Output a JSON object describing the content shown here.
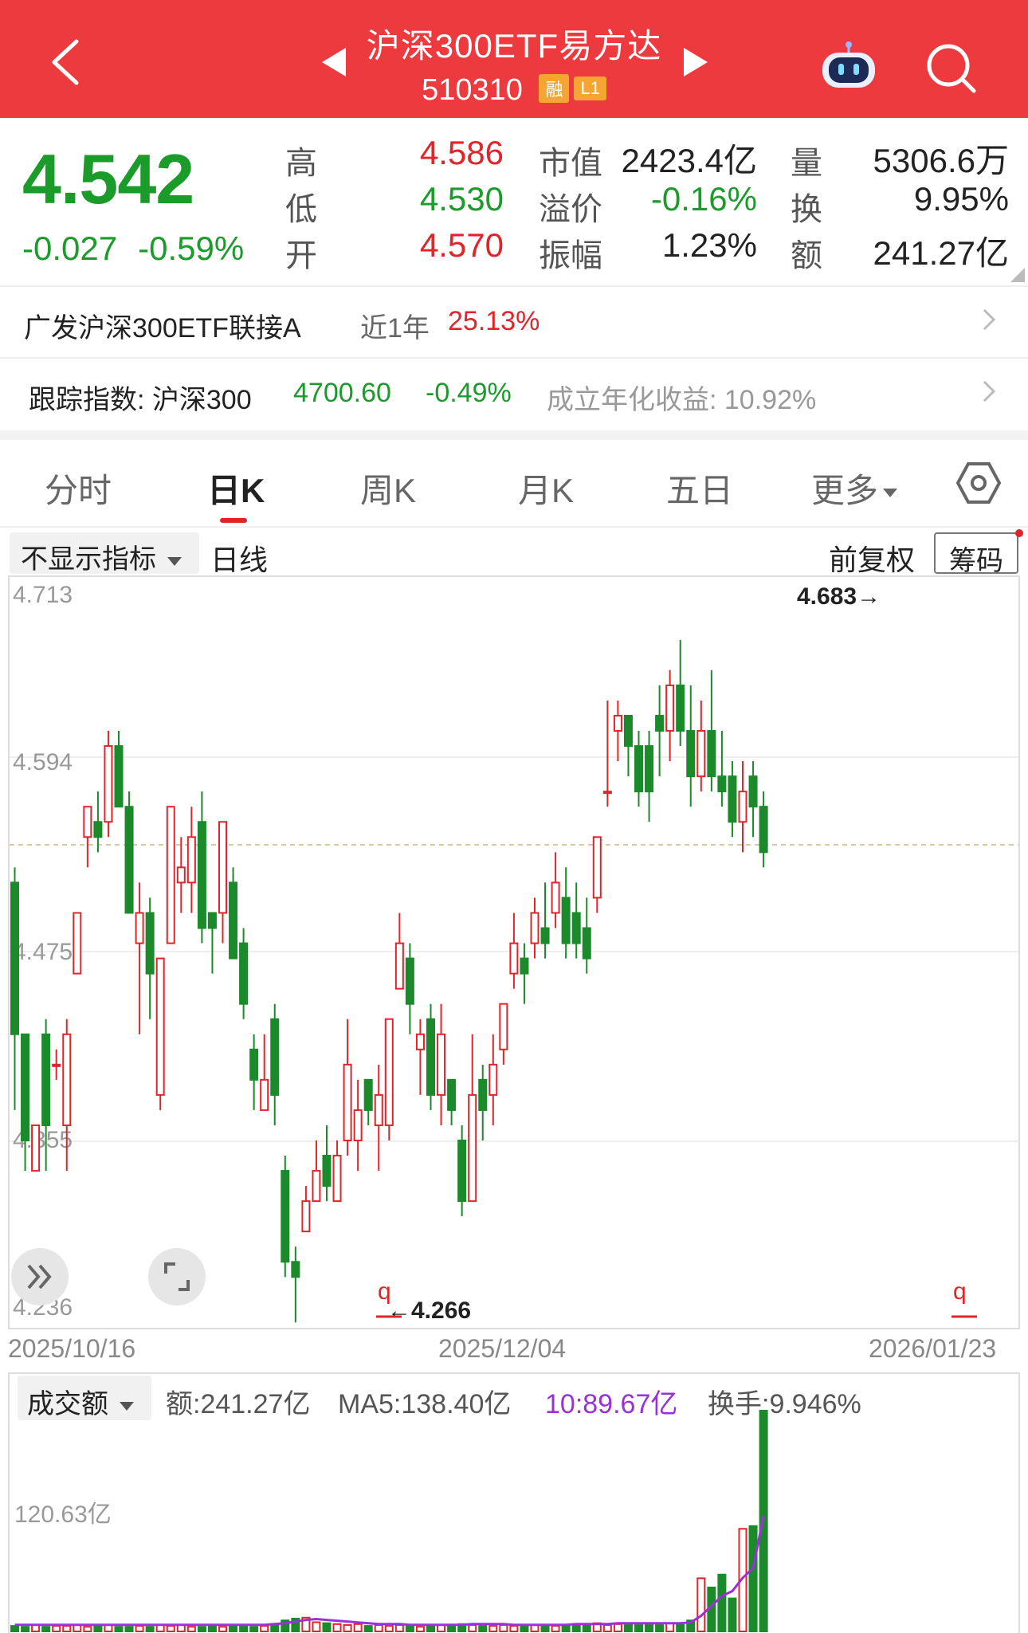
{
  "header": {
    "title": "沪深300ETF易方达",
    "code": "510310",
    "badge_margin": "融",
    "badge_level": "L1"
  },
  "quote": {
    "price": "4.542",
    "change": "-0.027",
    "change_pct": "-0.59%",
    "high_label": "高",
    "high": "4.586",
    "low_label": "低",
    "low": "4.530",
    "open_label": "开",
    "open": "4.570",
    "mktcap_label": "市值",
    "mktcap": "2423.4亿",
    "premium_label": "溢价",
    "premium": "-0.16%",
    "amp_label": "振幅",
    "amp": "1.23%",
    "vol_label": "量",
    "vol": "5306.6万",
    "turnover_label": "换",
    "turnover": "9.95%",
    "amount_label": "额",
    "amount": "241.27亿"
  },
  "fund_row": {
    "name": "广发沪深300ETF联接A",
    "period": "近1年",
    "return": "25.13%"
  },
  "index_row": {
    "label": "跟踪指数: 沪深300",
    "value": "4700.60",
    "change": "-0.49%",
    "annual": "成立年化收益: 10.92%"
  },
  "tabs": [
    "分时",
    "日K",
    "周K",
    "月K",
    "五日",
    "更多"
  ],
  "active_tab": "日K",
  "subbar": {
    "indicator": "不显示指标",
    "line_type": "日线",
    "adjust": "前复权",
    "chips": "筹码"
  },
  "colors": {
    "up": "#e1242a",
    "down": "#1a8a2a",
    "ma_purple": "#9b30d9"
  },
  "chart_data": [
    {
      "type": "candlestick",
      "y_ticks": [
        "4.713",
        "4.594",
        "4.475",
        "4.355",
        "4.236"
      ],
      "ylim": [
        4.236,
        4.713
      ],
      "x_tick_labels": [
        "2025/10/16",
        "2025/12/04",
        "2026/01/23"
      ],
      "max_annotation": "4.683→",
      "min_annotation": "←4.266",
      "candles": [
        [
          4.52,
          4.42,
          4.53,
          4.37
        ],
        [
          4.42,
          4.35,
          4.42,
          4.33
        ],
        [
          4.33,
          4.36,
          4.36,
          4.35
        ],
        [
          4.42,
          4.36,
          4.43,
          4.33
        ],
        [
          4.4,
          4.4,
          4.41,
          4.39
        ],
        [
          4.36,
          4.42,
          4.43,
          4.33
        ],
        [
          4.46,
          4.5,
          4.5,
          4.46
        ],
        [
          4.55,
          4.57,
          4.57,
          4.53
        ],
        [
          4.56,
          4.55,
          4.58,
          4.54
        ],
        [
          4.56,
          4.61,
          4.62,
          4.55
        ],
        [
          4.61,
          4.57,
          4.62,
          4.57
        ],
        [
          4.57,
          4.5,
          4.58,
          4.5
        ],
        [
          4.48,
          4.5,
          4.52,
          4.42
        ],
        [
          4.5,
          4.46,
          4.51,
          4.43
        ],
        [
          4.38,
          4.47,
          4.47,
          4.37
        ],
        [
          4.48,
          4.57,
          4.57,
          4.48
        ],
        [
          4.52,
          4.53,
          4.55,
          4.5
        ],
        [
          4.52,
          4.55,
          4.57,
          4.5
        ],
        [
          4.56,
          4.49,
          4.58,
          4.48
        ],
        [
          4.5,
          4.49,
          4.5,
          4.46
        ],
        [
          4.5,
          4.56,
          4.56,
          4.48
        ],
        [
          4.52,
          4.47,
          4.53,
          4.47
        ],
        [
          4.48,
          4.44,
          4.49,
          4.43
        ],
        [
          4.41,
          4.39,
          4.42,
          4.37
        ],
        [
          4.37,
          4.39,
          4.42,
          4.37
        ],
        [
          4.43,
          4.38,
          4.44,
          4.36
        ],
        [
          4.33,
          4.27,
          4.34,
          4.26
        ],
        [
          4.27,
          4.26,
          4.28,
          4.23
        ],
        [
          4.29,
          4.31,
          4.32,
          4.29
        ],
        [
          4.31,
          4.33,
          4.35,
          4.31
        ],
        [
          4.34,
          4.32,
          4.36,
          4.31
        ],
        [
          4.31,
          4.34,
          4.35,
          4.32
        ],
        [
          4.35,
          4.4,
          4.43,
          4.34
        ],
        [
          4.35,
          4.37,
          4.39,
          4.33
        ],
        [
          4.39,
          4.37,
          4.39,
          4.36
        ],
        [
          4.36,
          4.38,
          4.4,
          4.33
        ],
        [
          4.36,
          4.43,
          4.43,
          4.35
        ],
        [
          4.45,
          4.48,
          4.5,
          4.45
        ],
        [
          4.47,
          4.44,
          4.48,
          4.42
        ],
        [
          4.41,
          4.42,
          4.43,
          4.38
        ],
        [
          4.43,
          4.38,
          4.44,
          4.37
        ],
        [
          4.38,
          4.42,
          4.44,
          4.36
        ],
        [
          4.39,
          4.37,
          4.39,
          4.36
        ],
        [
          4.35,
          4.31,
          4.36,
          4.3
        ],
        [
          4.31,
          4.38,
          4.42,
          4.31
        ],
        [
          4.39,
          4.37,
          4.4,
          4.35
        ],
        [
          4.38,
          4.4,
          4.42,
          4.36
        ],
        [
          4.41,
          4.44,
          4.44,
          4.4
        ],
        [
          4.46,
          4.48,
          4.5,
          4.45
        ],
        [
          4.47,
          4.46,
          4.48,
          4.44
        ],
        [
          4.48,
          4.5,
          4.51,
          4.47
        ],
        [
          4.49,
          4.48,
          4.52,
          4.47
        ],
        [
          4.5,
          4.52,
          4.54,
          4.49
        ],
        [
          4.51,
          4.48,
          4.53,
          4.47
        ],
        [
          4.5,
          4.48,
          4.52,
          4.47
        ],
        [
          4.49,
          4.47,
          4.51,
          4.46
        ],
        [
          4.51,
          4.55,
          4.55,
          4.5
        ],
        [
          4.58,
          4.58,
          4.64,
          4.57
        ],
        [
          4.62,
          4.63,
          4.64,
          4.6
        ],
        [
          4.63,
          4.61,
          4.63,
          4.59
        ],
        [
          4.61,
          4.58,
          4.62,
          4.57
        ],
        [
          4.61,
          4.58,
          4.62,
          4.56
        ],
        [
          4.63,
          4.62,
          4.65,
          4.59
        ],
        [
          4.62,
          4.65,
          4.66,
          4.6
        ],
        [
          4.65,
          4.62,
          4.68,
          4.61
        ],
        [
          4.62,
          4.59,
          4.65,
          4.57
        ],
        [
          4.59,
          4.62,
          4.64,
          4.58
        ],
        [
          4.62,
          4.59,
          4.66,
          4.58
        ],
        [
          4.59,
          4.58,
          4.62,
          4.57
        ],
        [
          4.59,
          4.56,
          4.6,
          4.55
        ],
        [
          4.56,
          4.58,
          4.6,
          4.54
        ],
        [
          4.59,
          4.57,
          4.6,
          4.55
        ],
        [
          4.57,
          4.54,
          4.58,
          4.53
        ]
      ]
    },
    {
      "type": "bar",
      "title": "成交额",
      "label_amount": "额:241.27亿",
      "label_ma5": "MA5:138.40亿",
      "label_ma10": "10:89.67亿",
      "label_turnover": "换手:9.946%",
      "y_tick": "120.63亿",
      "values": [
        6,
        5,
        7,
        5,
        6,
        6,
        7,
        5,
        6,
        7,
        5,
        5,
        6,
        5,
        7,
        6,
        7,
        5,
        5,
        6,
        5,
        6,
        7,
        5,
        6,
        8,
        12,
        14,
        15,
        10,
        9,
        8,
        7,
        8,
        6,
        7,
        6,
        7,
        6,
        5,
        6,
        7,
        6,
        8,
        7,
        6,
        6,
        7,
        6,
        6,
        7,
        7,
        6,
        6,
        7,
        8,
        9,
        7,
        8,
        9,
        8,
        7,
        8,
        9,
        7,
        12,
        58,
        48,
        62,
        36,
        112,
        115,
        241
      ],
      "ma5": [
        6,
        6,
        6,
        6,
        6,
        6,
        6,
        6,
        6,
        6,
        6,
        6,
        6,
        6,
        6,
        6,
        6,
        6,
        6,
        6,
        6,
        6,
        6,
        6,
        6,
        7,
        8,
        10,
        12,
        13,
        12,
        11,
        10,
        9,
        8,
        7,
        7,
        7,
        6,
        6,
        6,
        6,
        6,
        6,
        7,
        7,
        7,
        7,
        6,
        6,
        6,
        6,
        6,
        6,
        7,
        7,
        7,
        7,
        8,
        8,
        8,
        8,
        8,
        8,
        8,
        9,
        17,
        29,
        41,
        47,
        63,
        75,
        138
      ]
    }
  ]
}
